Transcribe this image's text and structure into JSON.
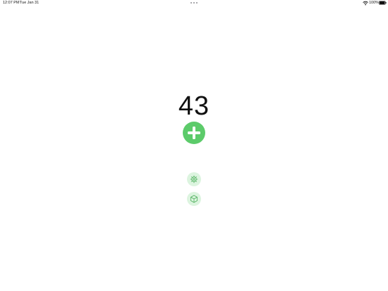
{
  "status_bar": {
    "time": "12:07 PM",
    "date": "Tue Jan 31",
    "battery_percent": "100%"
  },
  "counter": {
    "value": "43"
  },
  "buttons": {
    "add_icon": "plus-icon",
    "settings_icon": "gear-icon",
    "reset_icon": "cube-icon"
  },
  "colors": {
    "accent": "#5ccb6a",
    "accent_light": "#dcf4df",
    "icon_stroke": "#4caf5a"
  }
}
